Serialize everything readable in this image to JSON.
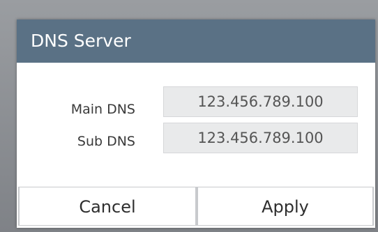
{
  "dialog": {
    "title": "DNS Server",
    "fields": [
      {
        "label": "Main DNS",
        "value": "123.456.789.100"
      },
      {
        "label": "Sub DNS",
        "value": "123.456.789.100"
      }
    ],
    "buttons": {
      "cancel": "Cancel",
      "apply": "Apply"
    }
  },
  "colors": {
    "title_bar": "#5a7185",
    "field_background": "#e9eaeb",
    "dialog_background": "#ffffff"
  }
}
